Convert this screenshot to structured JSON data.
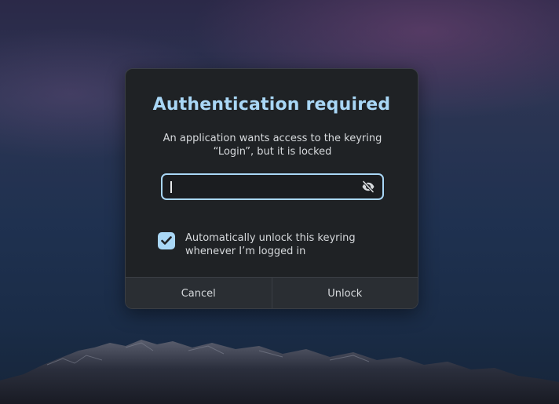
{
  "dialog": {
    "title": "Authentication required",
    "message_line1": "An application wants access to the keyring",
    "message_line2": "“Login”, but it is locked"
  },
  "password": {
    "value": "",
    "visibility_icon": "eye-slash-icon"
  },
  "auto_unlock": {
    "checked": true,
    "label_line1": "Automatically unlock this keyring",
    "label_line2": "whenever I’m logged in"
  },
  "buttons": {
    "cancel_label": "Cancel",
    "unlock_label": "Unlock"
  },
  "colors": {
    "accent": "#a9d7f6",
    "dialog_bg": "#1f2225",
    "button_bg": "#2a2e33",
    "text": "#d6d9dc"
  }
}
